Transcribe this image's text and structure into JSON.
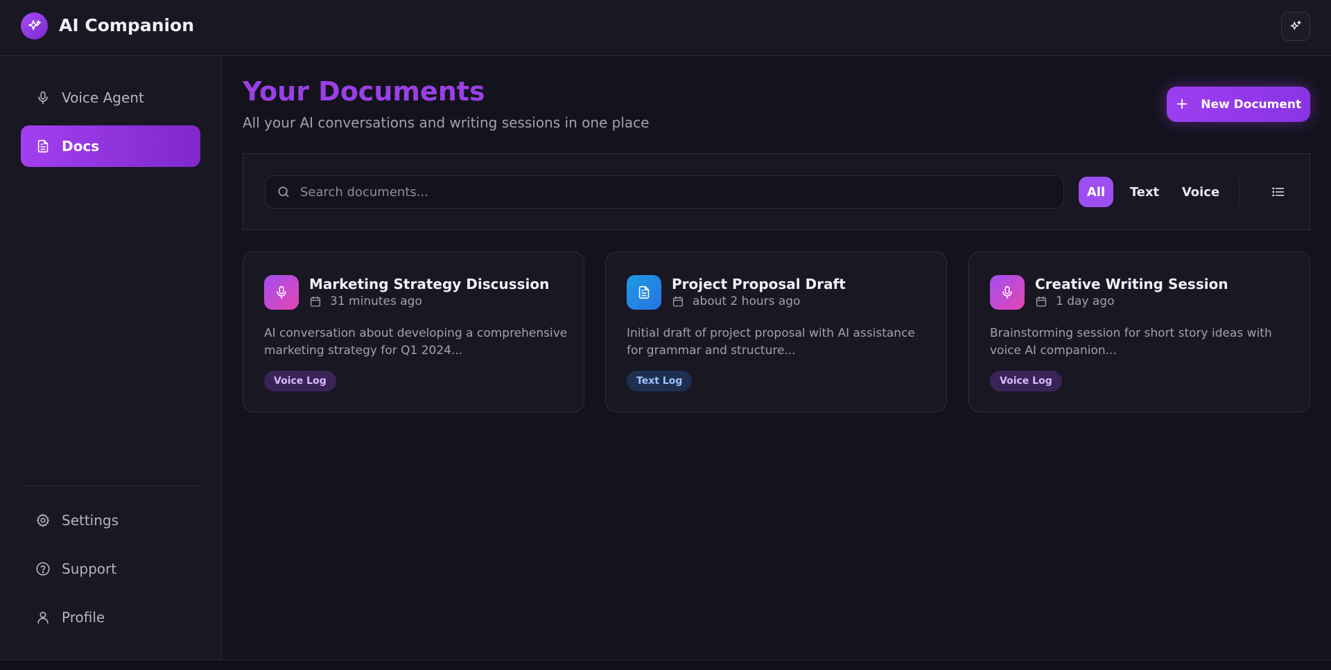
{
  "app": {
    "title": "AI Companion",
    "logo_icon": "sparkles-icon",
    "accent": "#9a40e6"
  },
  "sidebar": {
    "items": [
      {
        "label": "Voice Agent",
        "icon": "microphone-icon",
        "active": false
      },
      {
        "label": "Docs",
        "icon": "document-icon",
        "active": true
      }
    ],
    "bottom_items": [
      {
        "label": "Settings",
        "icon": "gear-icon"
      },
      {
        "label": "Support",
        "icon": "help-circle-icon"
      },
      {
        "label": "Profile",
        "icon": "user-icon"
      }
    ]
  },
  "main": {
    "title": "Your Documents",
    "subtitle": "All your AI conversations and writing sessions in one place",
    "new_button": "New Document",
    "search": {
      "placeholder": "Search documents..."
    },
    "filters": [
      {
        "label": "All",
        "active": true
      },
      {
        "label": "Text",
        "active": false
      },
      {
        "label": "Voice",
        "active": false
      }
    ],
    "documents": [
      {
        "type": "voice",
        "title": "Marketing Strategy Discussion",
        "time": "31 minutes ago",
        "description": "AI conversation about developing a comprehensive marketing strategy for Q1 2024...",
        "badge": "Voice Log"
      },
      {
        "type": "text",
        "title": "Project Proposal Draft",
        "time": "about 2 hours ago",
        "description": "Initial draft of project proposal with AI assistance for grammar and structure...",
        "badge": "Text Log"
      },
      {
        "type": "voice",
        "title": "Creative Writing Session",
        "time": "1 day ago",
        "description": "Brainstorming session for short story ideas with voice AI companion...",
        "badge": "Voice Log"
      }
    ]
  }
}
